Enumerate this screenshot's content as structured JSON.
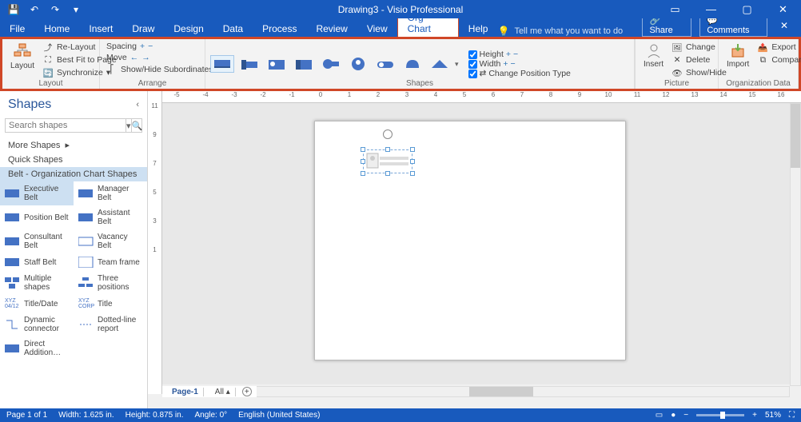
{
  "titlebar": {
    "title": "Drawing3 - Visio Professional"
  },
  "menu": {
    "tabs": [
      "File",
      "Home",
      "Insert",
      "Draw",
      "Design",
      "Data",
      "Process",
      "Review",
      "View",
      "Org Chart",
      "Help"
    ],
    "active": 9,
    "tellme_placeholder": "Tell me what you want to do",
    "share": "Share",
    "comments": "Comments"
  },
  "ribbon": {
    "layout": {
      "label": "Layout",
      "relayout": "Re-Layout",
      "bestfit": "Best Fit to Page",
      "sync": "Synchronize"
    },
    "arrange": {
      "label": "Arrange",
      "spacing": "Spacing",
      "move": "Move",
      "showhide": "Show/Hide Subordinates"
    },
    "shapes": {
      "label": "Shapes",
      "height": "Height",
      "width": "Width",
      "changepos": "Change Position Type"
    },
    "picture": {
      "label": "Picture",
      "insert": "Insert",
      "change": "Change",
      "delete": "Delete",
      "showhide": "Show/Hide"
    },
    "orgdata": {
      "label": "Organization Data",
      "import": "Import",
      "export": "Export",
      "compare": "Compare"
    }
  },
  "shapes_panel": {
    "title": "Shapes",
    "search_placeholder": "Search shapes",
    "more": "More Shapes",
    "quick": "Quick Shapes",
    "stencil_name": "Belt - Organization Chart Shapes",
    "items": [
      "Executive Belt",
      "Manager Belt",
      "Position Belt",
      "Assistant Belt",
      "Consultant Belt",
      "Vacancy Belt",
      "Staff Belt",
      "Team frame",
      "Multiple shapes",
      "Three positions",
      "Title/Date",
      "Title",
      "Dynamic connector",
      "Dotted-line report",
      "Direct Addition…",
      ""
    ]
  },
  "ruler": {
    "h": [
      "-5",
      "-4",
      "-3",
      "-2",
      "-1",
      "0",
      "1",
      "2",
      "3",
      "4",
      "5",
      "6",
      "7",
      "8",
      "9",
      "10",
      "11",
      "12",
      "13",
      "14",
      "15",
      "16"
    ],
    "v": [
      "11",
      "9",
      "7",
      "5",
      "3",
      "1"
    ]
  },
  "pagetabs": {
    "page": "Page-1",
    "all": "All"
  },
  "status": {
    "pages": "Page 1 of 1",
    "width": "Width: 1.625 in.",
    "height": "Height: 0.875 in.",
    "angle": "Angle: 0°",
    "lang": "English (United States)",
    "zoom": "51%"
  }
}
